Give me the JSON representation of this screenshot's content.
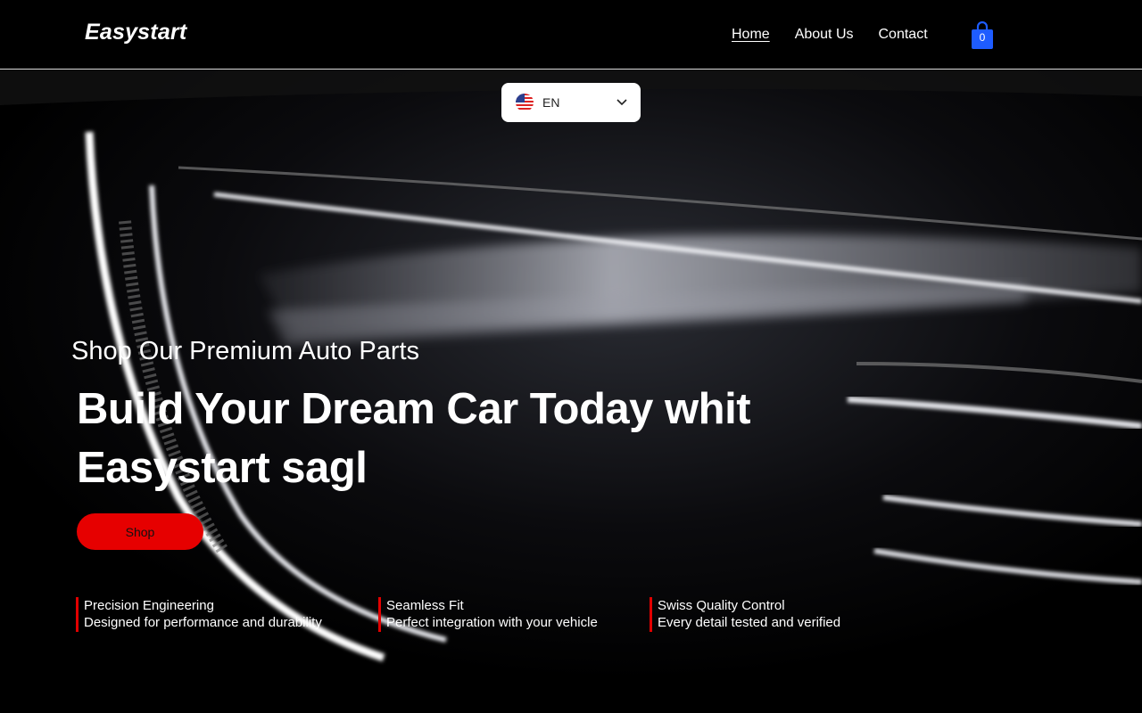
{
  "brand": {
    "logo": "Easystart"
  },
  "nav": {
    "items": [
      {
        "label": "Home",
        "active": true
      },
      {
        "label": "About Us",
        "active": false
      },
      {
        "label": "Contact",
        "active": false
      }
    ]
  },
  "cart": {
    "count": "0",
    "icon": "shopping-bag-icon",
    "color": "#1e5cff"
  },
  "language": {
    "code": "EN",
    "flag": "us-flag-icon"
  },
  "hero": {
    "subtitle": "Shop Our Premium Auto Parts",
    "headline_line1": "Build Your Dream Car Today whit",
    "headline_line2": "Easystart sagl",
    "cta_label": "Shop",
    "cta_color": "#e60000"
  },
  "features": [
    {
      "title": "Precision Engineering",
      "desc": "Designed for performance and durability"
    },
    {
      "title": "Seamless Fit",
      "desc": "Perfect integration with your vehicle"
    },
    {
      "title": "Swiss Quality Control",
      "desc": "Every detail tested and verified"
    }
  ],
  "accent_color": "#e10000"
}
